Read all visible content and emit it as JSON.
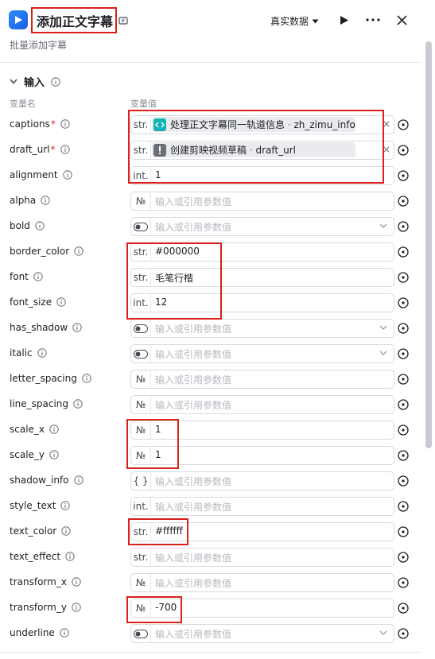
{
  "header": {
    "title": "添加正文字幕",
    "subtitle": "批量添加字幕",
    "data_mode": "真实数据"
  },
  "section": {
    "title": "输入",
    "col_name": "变量名",
    "col_value": "变量值"
  },
  "params": [
    {
      "name": "captions",
      "required": true,
      "type": "str.",
      "kind": "ref",
      "ref_icon": "code-block-icon",
      "ref_color": "#14b3b3",
      "ref_node": "处理正文字幕同一轨道信息",
      "ref_var": "zh_zimu_info"
    },
    {
      "name": "draft_url",
      "required": true,
      "type": "str.",
      "kind": "ref",
      "ref_icon": "plugin-warning-icon",
      "ref_color": "#6b6f76",
      "ref_node": "创建剪映视频草稿",
      "ref_var": "draft_url"
    },
    {
      "name": "alignment",
      "type": "int.",
      "kind": "value",
      "value": "1"
    },
    {
      "name": "alpha",
      "type": "№",
      "kind": "empty",
      "placeholder": "输入或引用参数值"
    },
    {
      "name": "bold",
      "type": "toggle",
      "kind": "empty",
      "placeholder": "输入或引用参数值",
      "dropdown": true
    },
    {
      "name": "border_color",
      "type": "str.",
      "kind": "value",
      "value": "#000000"
    },
    {
      "name": "font",
      "type": "str.",
      "kind": "value",
      "value": "毛笔行楷"
    },
    {
      "name": "font_size",
      "type": "int.",
      "kind": "value",
      "value": "12"
    },
    {
      "name": "has_shadow",
      "type": "toggle",
      "kind": "empty",
      "placeholder": "输入或引用参数值",
      "dropdown": true
    },
    {
      "name": "italic",
      "type": "toggle",
      "kind": "empty",
      "placeholder": "输入或引用参数值",
      "dropdown": true
    },
    {
      "name": "letter_spacing",
      "type": "№",
      "kind": "empty",
      "placeholder": "输入或引用参数值"
    },
    {
      "name": "line_spacing",
      "type": "№",
      "kind": "empty",
      "placeholder": "输入或引用参数值"
    },
    {
      "name": "scale_x",
      "type": "№",
      "kind": "value",
      "value": "1"
    },
    {
      "name": "scale_y",
      "type": "№",
      "kind": "value",
      "value": "1"
    },
    {
      "name": "shadow_info",
      "type": "{ }",
      "kind": "empty",
      "placeholder": "输入或引用参数值"
    },
    {
      "name": "style_text",
      "type": "int.",
      "kind": "empty",
      "placeholder": "输入或引用参数值"
    },
    {
      "name": "text_color",
      "type": "str.",
      "kind": "value",
      "value": "#ffffff"
    },
    {
      "name": "text_effect",
      "type": "str.",
      "kind": "empty",
      "placeholder": "输入或引用参数值"
    },
    {
      "name": "transform_x",
      "type": "№",
      "kind": "empty",
      "placeholder": "输入或引用参数值"
    },
    {
      "name": "transform_y",
      "type": "№",
      "kind": "value",
      "value": "-700"
    },
    {
      "name": "underline",
      "type": "toggle",
      "kind": "empty",
      "placeholder": "输入或引用参数值",
      "dropdown": true
    }
  ],
  "colors": {
    "highlight": "#d9201b",
    "required": "#e0282e",
    "brand": "#2e8cff"
  }
}
